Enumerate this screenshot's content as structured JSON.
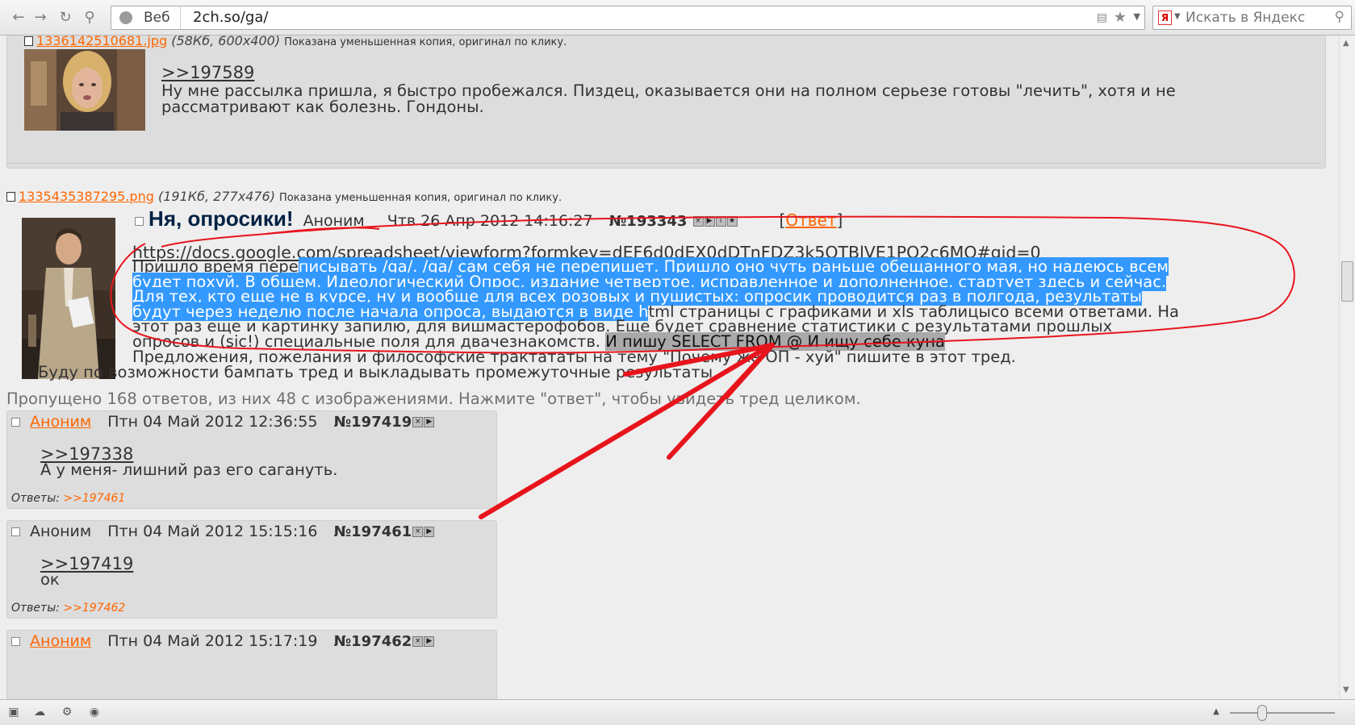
{
  "browser": {
    "search_mode": "Веб",
    "url": "2ch.so/ga/",
    "search_placeholder": "Искать в Яндекс",
    "yandex_logo": "Я"
  },
  "top_post": {
    "file_name": "1336142510681.jpg",
    "file_meta": "(58Кб, 600x400)",
    "file_note": "Показана уменьшенная копия, оригинал по клику.",
    "quote_link": ">>197589",
    "text": "Ну мне рассылка пришла, я быстро пробежался. Пиздец, оказывается они на полном серьезе готовы \"лечить\", хотя и не рассматривают как болезнь. Гондоны."
  },
  "op_post": {
    "file_name": "1335435387295.png",
    "file_meta": "(191Кб, 277x476)",
    "file_note": "Показана уменьшенная копия, оригинал по клику.",
    "subject": "Ня, опросики!",
    "author": "Аноним",
    "date": "Чтв 26 Апр 2012 14:16:27",
    "number": "№193343",
    "reply_label": "Ответ",
    "url_link": "https://docs.google.com/spreadsheet/viewform?formkey=dEF6d0dEX0dDTnFDZ3k5OTBlVE1PQ2c6MQ#gid=0",
    "line1_a": "Пришло время пере",
    "line1_b": "писывать /ga/. /ga/ сам себя не перепишет. Пришло оно чуть раньше обещанного мая, но надеюсь всем",
    "line2": "будет похуй. В общем, Идеологический Опрос, издание четвертое, исправленное и дополненное, стартует здесь и сейчас.",
    "line3": "Для тех, кто еще не в курсе, ну и вообще для всех розовых и пушистых: опросик проводится раз в полгода, результаты",
    "line4_a": "будут через неделю после начала опроса, выдаются в виде h",
    "line4_b": "tml страницы с графиками и xls таблицысо всеми ответами. На",
    "line5": "этот раз еще и картинку запилю, для вишмастерофобов. Еще будет сравнение статистики с результатами прошлых",
    "line6_a": "опросов и (sic!) специальные поля для двачезнакомств. ",
    "line6_b": "И пишу SELECT FROM @ И ищу себе куна",
    "line7": "Предложения, пожелания и философские трактататы на тему \"Почему же ОП - хуй\" пишите в этот тред.",
    "line8": "Буду по возможности бампать тред и выкладывать промежуточные результаты."
  },
  "omitted": "Пропущено 168 ответов, из них 48 с изображениями. Нажмите \"ответ\", чтобы увидеть тред целиком.",
  "replies": [
    {
      "author": "Аноним",
      "date": "Птн 04 Май 2012 12:36:55",
      "number": "№197419",
      "quote": ">>197338",
      "text": "А у меня- лишний раз его сагануть.",
      "answers_label": "Ответы:",
      "answers_link": ">>197461"
    },
    {
      "author": "Аноним",
      "date": "Птн 04 Май 2012 15:15:16",
      "number": "№197461",
      "quote": ">>197419",
      "text": "ок",
      "answers_label": "Ответы:",
      "answers_link": ">>197462"
    },
    {
      "author": "Аноним",
      "date": "Птн 04 Май 2012 15:17:19",
      "number": "№197462"
    }
  ],
  "colors": {
    "link": "#ff6600",
    "selection": "#3399ff",
    "annotation": "#e8141c",
    "post_bg": "#dddddd",
    "subject": "#002244"
  },
  "icons": {
    "back": "arrow-left-icon",
    "forward": "arrow-right-icon",
    "reload": "reload-icon",
    "key": "key-icon",
    "star": "star-icon",
    "search": "magnifier-icon"
  }
}
